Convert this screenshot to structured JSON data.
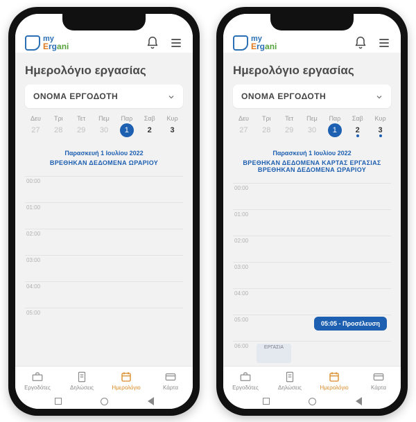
{
  "logo": {
    "line1": "my",
    "line2": "Ergani"
  },
  "page_title": "Ημερολόγιο εργασίας",
  "employer_dropdown": "ΟΝΟΜΑ ΕΡΓΟΔΟΤΗ",
  "weekday_labels": [
    "Δευ",
    "Τρι",
    "Τετ",
    "Πεμ",
    "Παρ",
    "Σαβ",
    "Κυρ"
  ],
  "date_header": "Παρασκευή 1 Ιουλίου 2022",
  "found_schedule": "ΒΡΕΘΗΚΑΝ ΔΕΔΟΜΕΝΑ ΩΡΑΡΙΟΥ",
  "found_card": "ΒΡΕΘΗΚΑΝ ΔΕΔΟΜΕΝΑ ΚΑΡΤΑΣ ΕΡΓΑΣΙΑΣ",
  "hours": [
    "00:00",
    "01:00",
    "02:00",
    "03:00",
    "04:00",
    "05:00",
    "06:00"
  ],
  "event_pill": "05:05 - Προσέλευση",
  "work_block": "ΕΡΓΑΣΙΑ",
  "nav": {
    "employers": "Εργοδότες",
    "declarations": "Δηλώσεις",
    "calendar": "Ημερολόγιο",
    "card": "Κάρτα"
  },
  "left": {
    "week_numbers": [
      "27",
      "28",
      "29",
      "30",
      "1",
      "2",
      "3"
    ]
  },
  "right": {
    "week_numbers": [
      "27",
      "28",
      "29",
      "30",
      "1",
      "2",
      "3"
    ]
  }
}
